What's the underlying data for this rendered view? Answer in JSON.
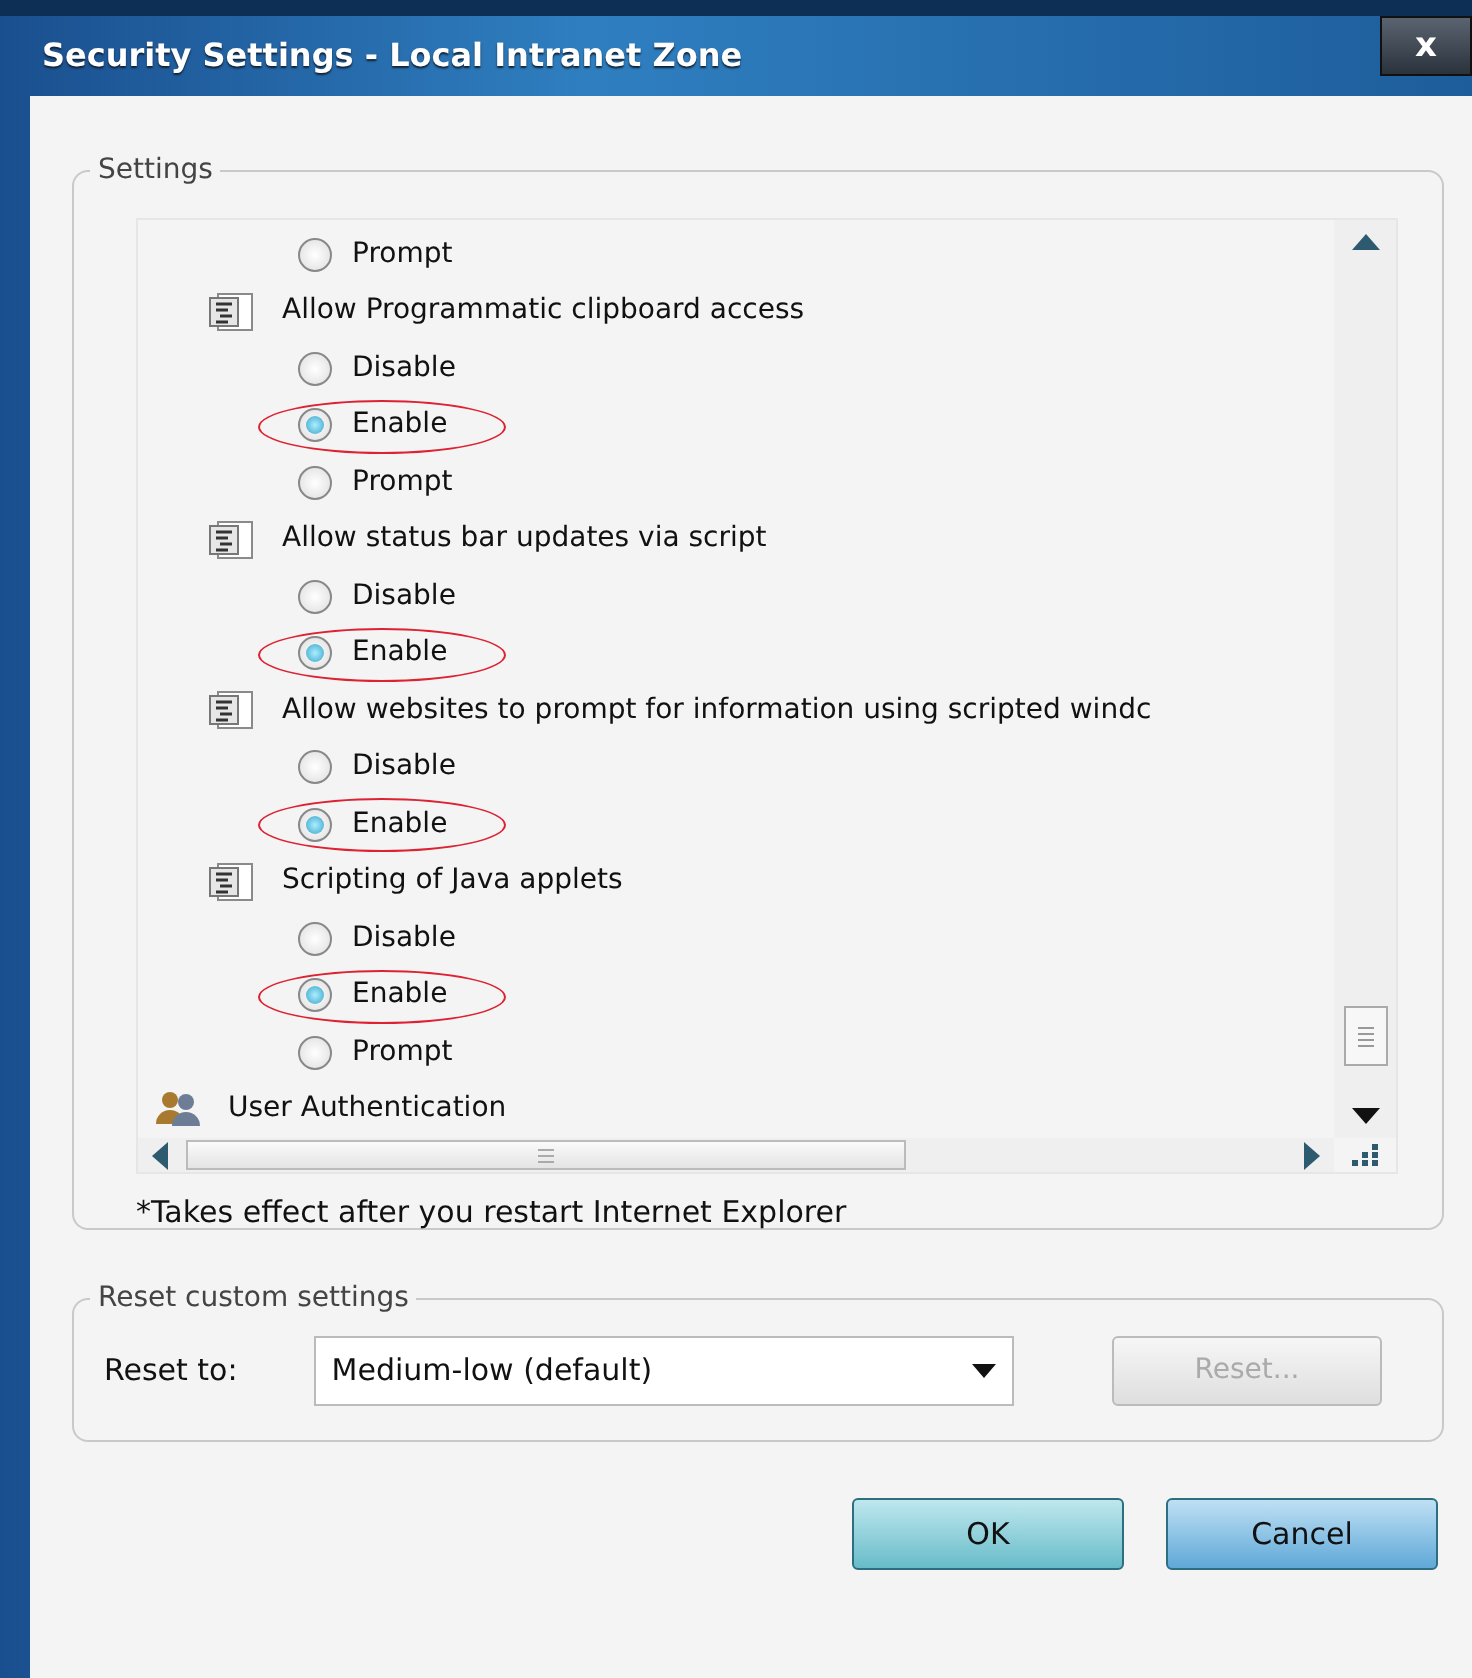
{
  "window": {
    "title": "Security Settings - Local Intranet Zone",
    "close": "x"
  },
  "settings": {
    "legend": "Settings",
    "items": [
      {
        "kind": "option",
        "label": "Prompt",
        "selected": false,
        "circled": false
      },
      {
        "kind": "heading",
        "label": "Allow Programmatic clipboard access"
      },
      {
        "kind": "option",
        "label": "Disable",
        "selected": false,
        "circled": false
      },
      {
        "kind": "option",
        "label": "Enable",
        "selected": true,
        "circled": true
      },
      {
        "kind": "option",
        "label": "Prompt",
        "selected": false,
        "circled": false
      },
      {
        "kind": "heading",
        "label": "Allow status bar updates via script"
      },
      {
        "kind": "option",
        "label": "Disable",
        "selected": false,
        "circled": false
      },
      {
        "kind": "option",
        "label": "Enable",
        "selected": true,
        "circled": true
      },
      {
        "kind": "heading",
        "label": "Allow websites to prompt for information using scripted windc"
      },
      {
        "kind": "option",
        "label": "Disable",
        "selected": false,
        "circled": false
      },
      {
        "kind": "option",
        "label": "Enable",
        "selected": true,
        "circled": true
      },
      {
        "kind": "heading",
        "label": "Scripting of Java applets"
      },
      {
        "kind": "option",
        "label": "Disable",
        "selected": false,
        "circled": false
      },
      {
        "kind": "option",
        "label": "Enable",
        "selected": true,
        "circled": true
      },
      {
        "kind": "option",
        "label": "Prompt",
        "selected": false,
        "circled": false
      },
      {
        "kind": "category",
        "label": "User Authentication"
      }
    ],
    "note": "*Takes effect after you restart Internet Explorer"
  },
  "reset": {
    "legend": "Reset custom settings",
    "label": "Reset to:",
    "value": "Medium-low (default)",
    "button": {
      "label": "Reset...",
      "disabled": true
    }
  },
  "buttons": [
    {
      "label": "OK",
      "kind": "ok"
    },
    {
      "label": "Cancel",
      "kind": "cancel"
    }
  ]
}
